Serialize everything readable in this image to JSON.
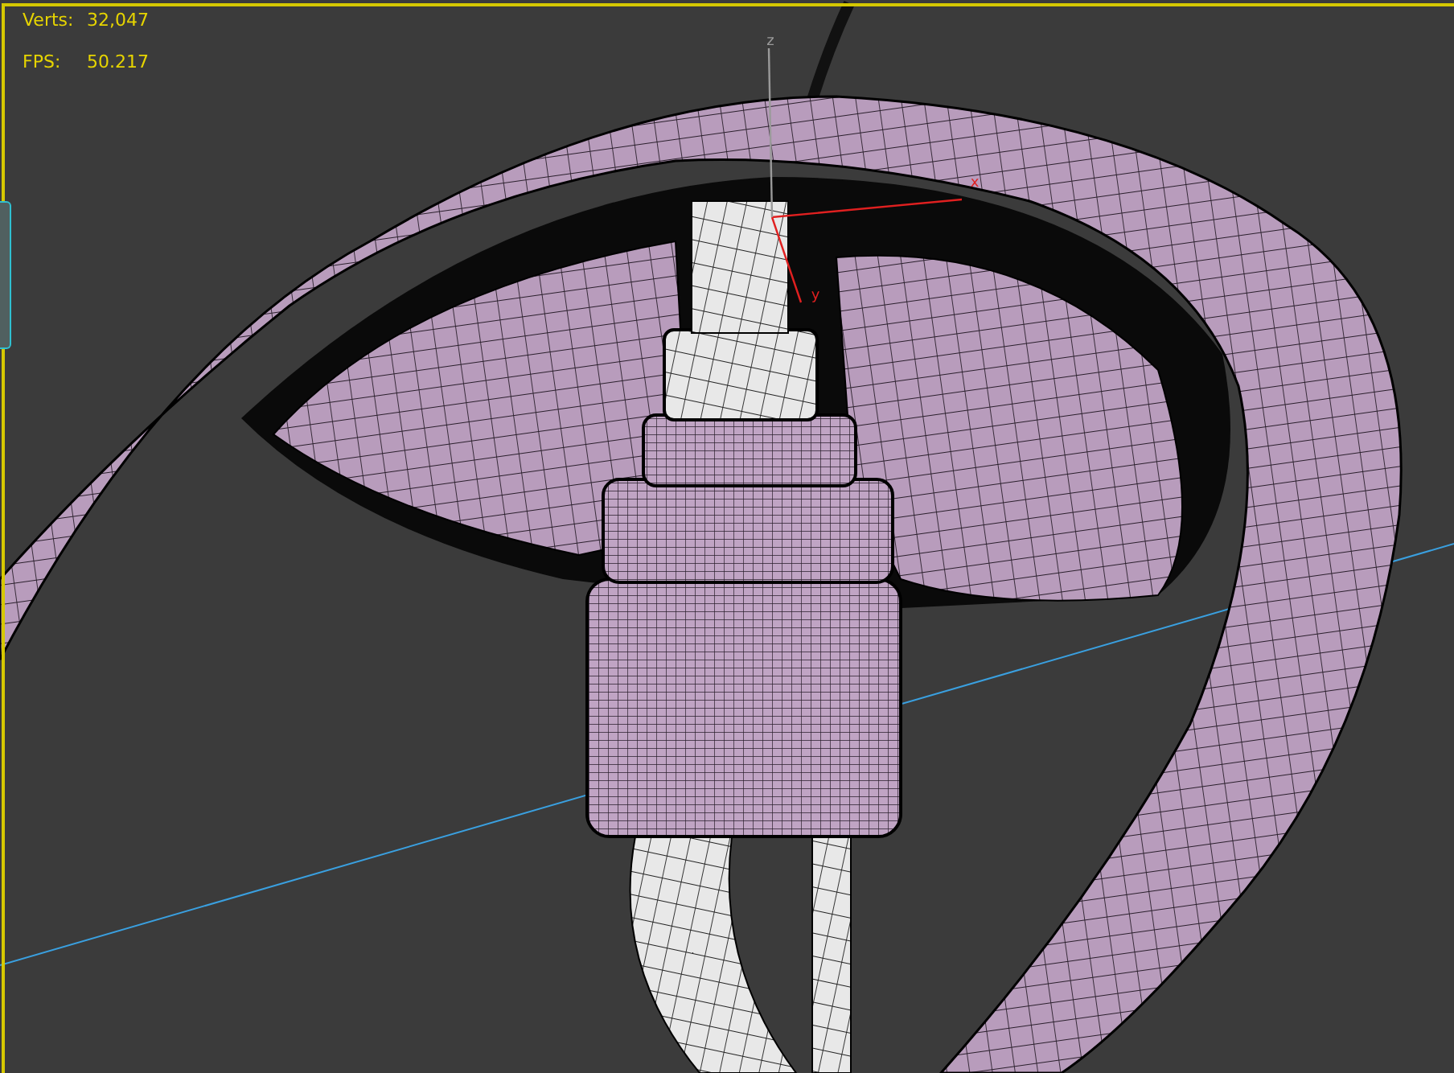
{
  "viewport": {
    "stats": [
      {
        "label": "Verts:",
        "value": "32,047"
      },
      {
        "label": "FPS:",
        "value": "50.217"
      }
    ],
    "gizmo": {
      "axes": [
        {
          "label": "x",
          "color": "#e02020"
        },
        {
          "label": "y",
          "color": "#e02020"
        },
        {
          "label": "z",
          "color": "#9a9a9a"
        }
      ]
    }
  }
}
